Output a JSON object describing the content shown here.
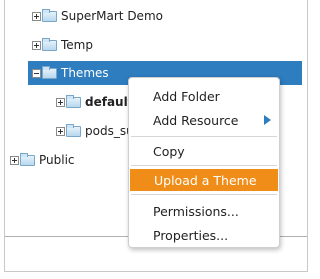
{
  "tree": {
    "items": [
      {
        "label": "SuperMart Demo",
        "expander": "plus",
        "selected": false
      },
      {
        "label": "Temp",
        "expander": "plus",
        "selected": false
      },
      {
        "label": "Themes",
        "expander": "minus",
        "selected": true
      },
      {
        "label": "default",
        "expander": "plus",
        "selected": false,
        "bold": true
      },
      {
        "label": "pods_sur",
        "expander": "plus",
        "selected": false
      },
      {
        "label": "Public",
        "expander": "plus",
        "selected": false
      }
    ]
  },
  "context_menu": {
    "items": [
      {
        "label": "Add Folder"
      },
      {
        "label": "Add Resource",
        "submenu": true
      },
      {
        "label": "Copy"
      },
      {
        "label": "Upload a Theme",
        "highlighted": true
      },
      {
        "label": "Permissions..."
      },
      {
        "label": "Properties..."
      }
    ]
  },
  "colors": {
    "selection": "#2d7dbf",
    "menu_highlight": "#f08d18"
  }
}
